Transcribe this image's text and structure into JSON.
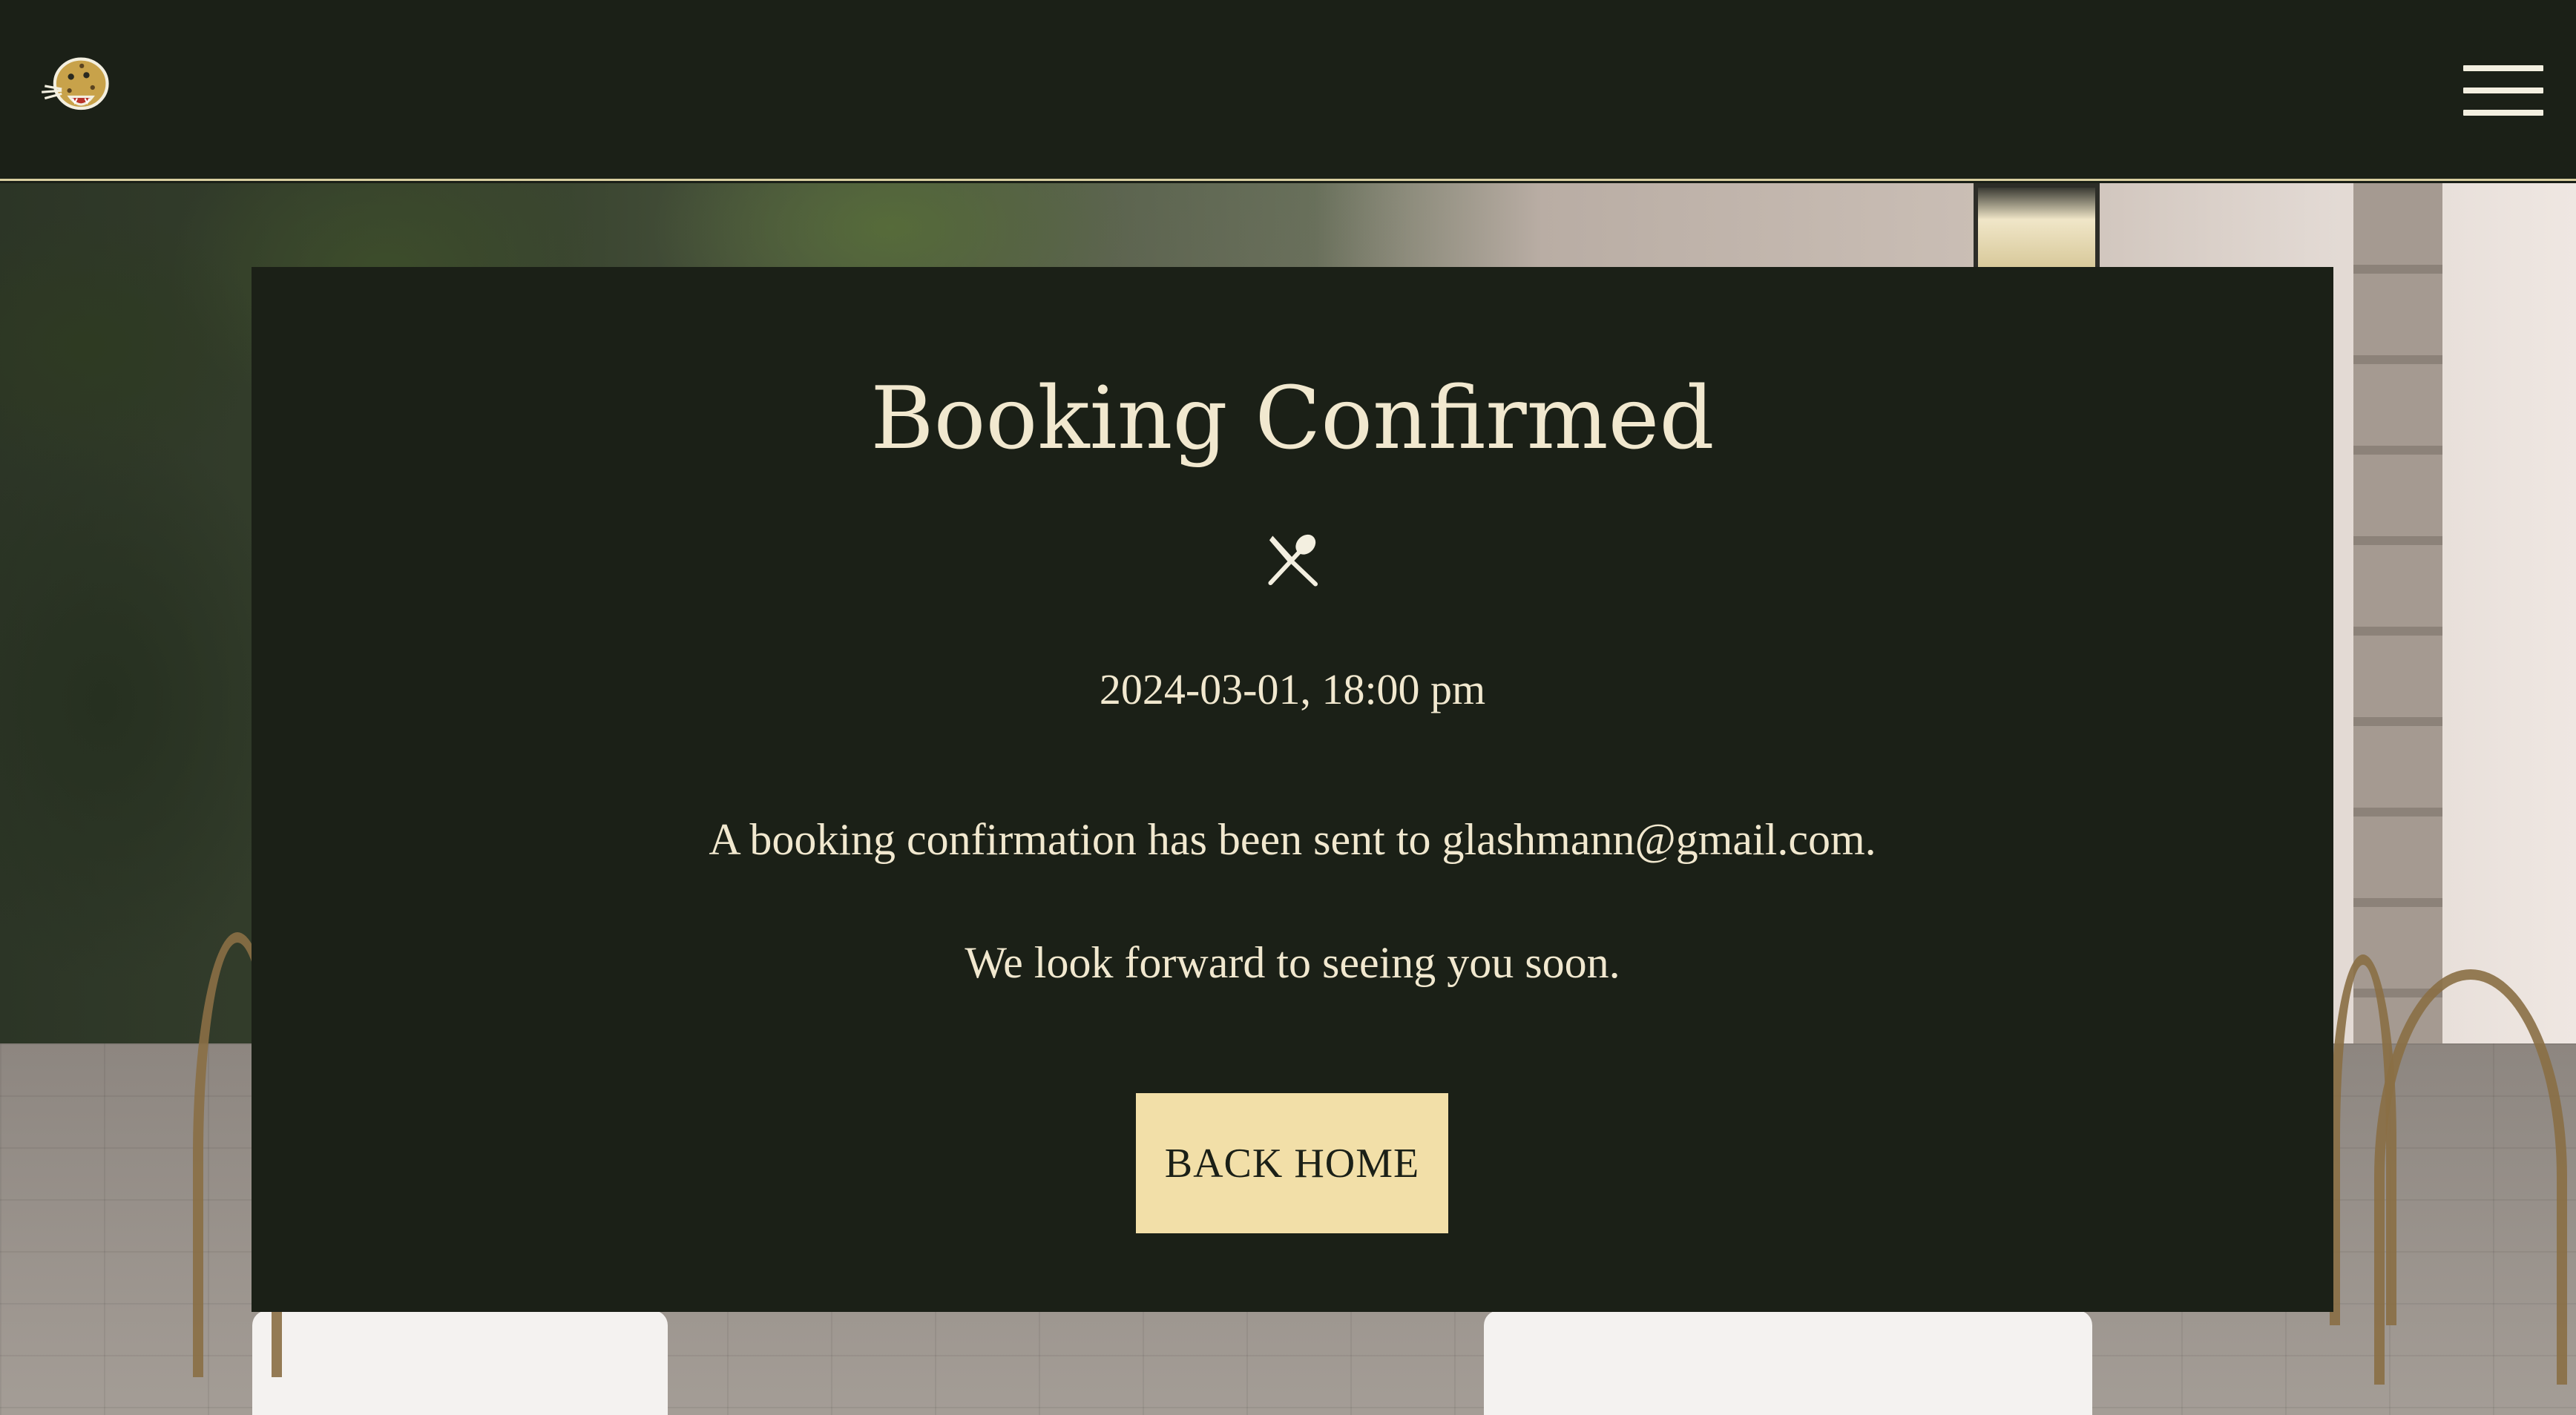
{
  "header": {
    "logo_icon": "jaguar-logo-icon",
    "menu_icon": "hamburger-menu-icon"
  },
  "card": {
    "title": "Booking Confirmed",
    "divider_icon": "crossed-knife-spoon-icon",
    "datetime": "2024-03-01, 18:00 pm",
    "confirmation_message": "A booking confirmation has been sent to glashmann@gmail.com.",
    "closing_message": "We look forward to seeing you soon.",
    "back_home_label": "BACK HOME"
  },
  "colors": {
    "header_bg": "#1b2017",
    "card_bg": "#1b2017",
    "text_cream": "#f1e8cf",
    "button_bg": "#f2dfa8",
    "header_border": "#d9cfa0"
  }
}
